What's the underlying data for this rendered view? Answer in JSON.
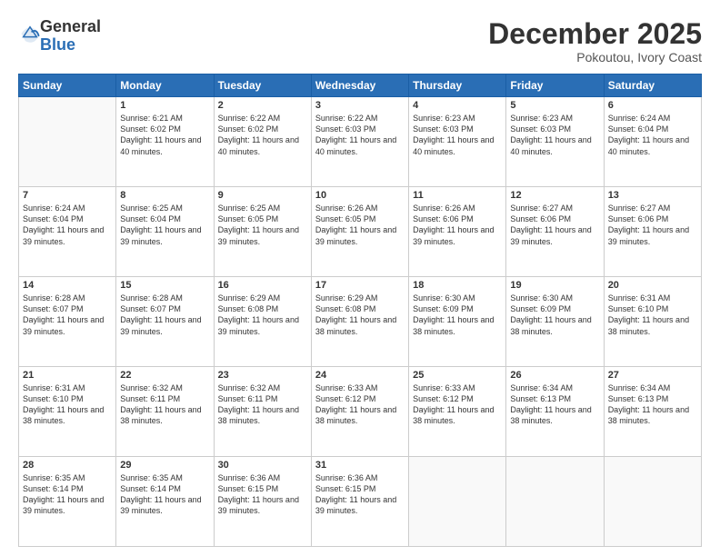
{
  "header": {
    "logo_general": "General",
    "logo_blue": "Blue",
    "month_title": "December 2025",
    "subtitle": "Pokoutou, Ivory Coast"
  },
  "days_of_week": [
    "Sunday",
    "Monday",
    "Tuesday",
    "Wednesday",
    "Thursday",
    "Friday",
    "Saturday"
  ],
  "weeks": [
    [
      {
        "day": "",
        "sunrise": "",
        "sunset": "",
        "daylight": "",
        "empty": true
      },
      {
        "day": "1",
        "sunrise": "6:21 AM",
        "sunset": "6:02 PM",
        "daylight": "11 hours and 40 minutes."
      },
      {
        "day": "2",
        "sunrise": "6:22 AM",
        "sunset": "6:02 PM",
        "daylight": "11 hours and 40 minutes."
      },
      {
        "day": "3",
        "sunrise": "6:22 AM",
        "sunset": "6:03 PM",
        "daylight": "11 hours and 40 minutes."
      },
      {
        "day": "4",
        "sunrise": "6:23 AM",
        "sunset": "6:03 PM",
        "daylight": "11 hours and 40 minutes."
      },
      {
        "day": "5",
        "sunrise": "6:23 AM",
        "sunset": "6:03 PM",
        "daylight": "11 hours and 40 minutes."
      },
      {
        "day": "6",
        "sunrise": "6:24 AM",
        "sunset": "6:04 PM",
        "daylight": "11 hours and 40 minutes."
      }
    ],
    [
      {
        "day": "7",
        "sunrise": "6:24 AM",
        "sunset": "6:04 PM",
        "daylight": "11 hours and 39 minutes."
      },
      {
        "day": "8",
        "sunrise": "6:25 AM",
        "sunset": "6:04 PM",
        "daylight": "11 hours and 39 minutes."
      },
      {
        "day": "9",
        "sunrise": "6:25 AM",
        "sunset": "6:05 PM",
        "daylight": "11 hours and 39 minutes."
      },
      {
        "day": "10",
        "sunrise": "6:26 AM",
        "sunset": "6:05 PM",
        "daylight": "11 hours and 39 minutes."
      },
      {
        "day": "11",
        "sunrise": "6:26 AM",
        "sunset": "6:06 PM",
        "daylight": "11 hours and 39 minutes."
      },
      {
        "day": "12",
        "sunrise": "6:27 AM",
        "sunset": "6:06 PM",
        "daylight": "11 hours and 39 minutes."
      },
      {
        "day": "13",
        "sunrise": "6:27 AM",
        "sunset": "6:06 PM",
        "daylight": "11 hours and 39 minutes."
      }
    ],
    [
      {
        "day": "14",
        "sunrise": "6:28 AM",
        "sunset": "6:07 PM",
        "daylight": "11 hours and 39 minutes."
      },
      {
        "day": "15",
        "sunrise": "6:28 AM",
        "sunset": "6:07 PM",
        "daylight": "11 hours and 39 minutes."
      },
      {
        "day": "16",
        "sunrise": "6:29 AM",
        "sunset": "6:08 PM",
        "daylight": "11 hours and 39 minutes."
      },
      {
        "day": "17",
        "sunrise": "6:29 AM",
        "sunset": "6:08 PM",
        "daylight": "11 hours and 38 minutes."
      },
      {
        "day": "18",
        "sunrise": "6:30 AM",
        "sunset": "6:09 PM",
        "daylight": "11 hours and 38 minutes."
      },
      {
        "day": "19",
        "sunrise": "6:30 AM",
        "sunset": "6:09 PM",
        "daylight": "11 hours and 38 minutes."
      },
      {
        "day": "20",
        "sunrise": "6:31 AM",
        "sunset": "6:10 PM",
        "daylight": "11 hours and 38 minutes."
      }
    ],
    [
      {
        "day": "21",
        "sunrise": "6:31 AM",
        "sunset": "6:10 PM",
        "daylight": "11 hours and 38 minutes."
      },
      {
        "day": "22",
        "sunrise": "6:32 AM",
        "sunset": "6:11 PM",
        "daylight": "11 hours and 38 minutes."
      },
      {
        "day": "23",
        "sunrise": "6:32 AM",
        "sunset": "6:11 PM",
        "daylight": "11 hours and 38 minutes."
      },
      {
        "day": "24",
        "sunrise": "6:33 AM",
        "sunset": "6:12 PM",
        "daylight": "11 hours and 38 minutes."
      },
      {
        "day": "25",
        "sunrise": "6:33 AM",
        "sunset": "6:12 PM",
        "daylight": "11 hours and 38 minutes."
      },
      {
        "day": "26",
        "sunrise": "6:34 AM",
        "sunset": "6:13 PM",
        "daylight": "11 hours and 38 minutes."
      },
      {
        "day": "27",
        "sunrise": "6:34 AM",
        "sunset": "6:13 PM",
        "daylight": "11 hours and 38 minutes."
      }
    ],
    [
      {
        "day": "28",
        "sunrise": "6:35 AM",
        "sunset": "6:14 PM",
        "daylight": "11 hours and 39 minutes."
      },
      {
        "day": "29",
        "sunrise": "6:35 AM",
        "sunset": "6:14 PM",
        "daylight": "11 hours and 39 minutes."
      },
      {
        "day": "30",
        "sunrise": "6:36 AM",
        "sunset": "6:15 PM",
        "daylight": "11 hours and 39 minutes."
      },
      {
        "day": "31",
        "sunrise": "6:36 AM",
        "sunset": "6:15 PM",
        "daylight": "11 hours and 39 minutes."
      },
      {
        "day": "",
        "empty": true
      },
      {
        "day": "",
        "empty": true
      },
      {
        "day": "",
        "empty": true
      }
    ]
  ]
}
